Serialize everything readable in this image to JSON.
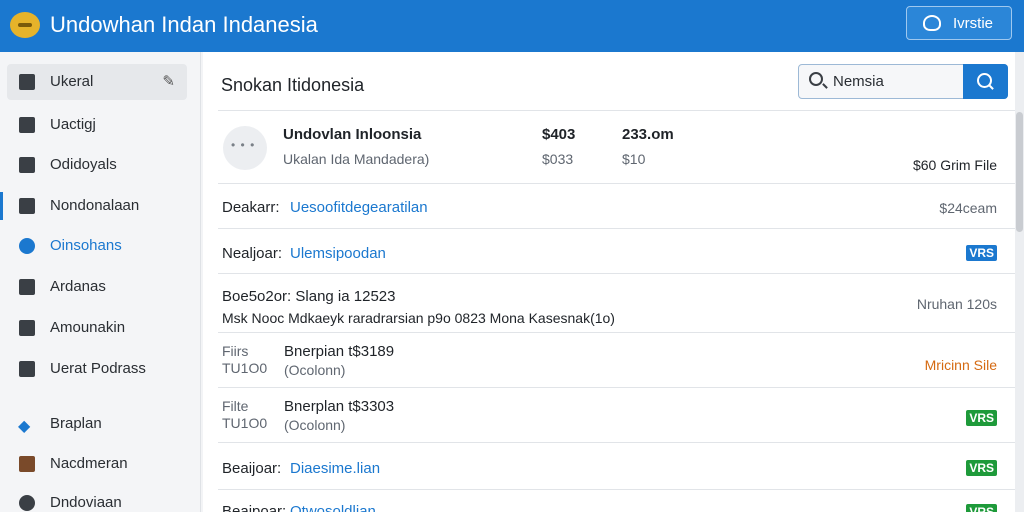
{
  "app": {
    "title": "Undowhan Indan Indanesia",
    "top_button_label": "Ivrstie"
  },
  "sidebar": {
    "items": [
      {
        "label": "Ukeral",
        "icon": "folder-icon"
      },
      {
        "label": "Uactigj",
        "icon": "document-icon"
      },
      {
        "label": "Odidoyals",
        "icon": "image-icon"
      },
      {
        "label": "Nondonalaan",
        "icon": "mail-icon"
      },
      {
        "label": "Oinsohans",
        "icon": "gear-icon"
      },
      {
        "label": "Ardanas",
        "icon": "envelope-icon"
      },
      {
        "label": "Amounakin",
        "icon": "card-icon"
      },
      {
        "label": "Uerat Podrass",
        "icon": "file-icon"
      },
      {
        "label": "Braplan",
        "icon": "tag-icon"
      },
      {
        "label": "Nacdmeran",
        "icon": "package-icon"
      },
      {
        "label": "Dndoviaan",
        "icon": "settings-icon"
      }
    ]
  },
  "main": {
    "title": "Snokan Itidonesia",
    "search": {
      "value": "Nemsia"
    },
    "first_row": {
      "name": "Undovlan Inloonsia",
      "subtitle": "Ukalan Ida Mandadera)",
      "amount1": "$403",
      "amount1_sub": "$033",
      "amount2": "233.om",
      "amount2_sub": "$10",
      "right": "$60 Grim File"
    },
    "rows": [
      {
        "label": "Deakarr:",
        "link": "Uesoofitdegearatilan",
        "right": "$24ceam"
      },
      {
        "label": "Nealjoar:",
        "link": "Ulemsipoodan",
        "badge": "VRS",
        "badge_color": "#1b78cf"
      },
      {
        "label": "Boe5o2or: Slang ia 12523",
        "detail": "Msk Nooc Mdkaeyk raradrarsian p9o 0823 Mona Kasesnak(1o)",
        "right": "Nruhan 120s"
      },
      {
        "label": "Fiirs",
        "sub": "TU1O0",
        "title": "Bnerpian t$3189",
        "title_sub": "(Ocolonn)",
        "right": "Mricinn Sile",
        "right_color": "#d56a12"
      },
      {
        "label": "Filte",
        "sub": "TU1O0",
        "title": "Bnerplan t$3303",
        "title_sub": "(Ocolonn)",
        "badge": "VRS",
        "badge_color": "#1e9a3a"
      },
      {
        "label": "Beaijoar:",
        "link": "Diaesime.lian",
        "badge": "VRS",
        "badge_color": "#1e9a3a"
      },
      {
        "label": "Beaipoar:",
        "link": "Otwosoldlian",
        "badge": "VRS",
        "badge_color": "#1e9a3a"
      }
    ]
  }
}
